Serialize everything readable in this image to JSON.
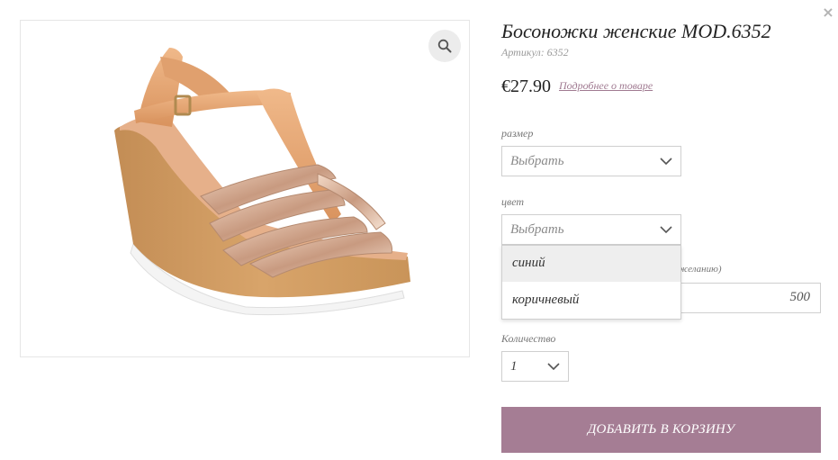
{
  "product": {
    "title": "Босоножки женские MOD.6352",
    "sku": "Артикул: 6352",
    "price": "€27.90",
    "details_link": "Подробнее о товаре",
    "image_alt": "sandal-image"
  },
  "options": {
    "size_label": "размер",
    "size_value": "Выбрать",
    "color_label": "цвет",
    "color_value": "Выбрать",
    "color_options": [
      "синий",
      "коричневый"
    ],
    "engraving_label_visible": "желанию)",
    "engraving_value": "500",
    "quantity_label": "Количество",
    "quantity_value": "1"
  },
  "actions": {
    "add_to_cart": "ДОБАВИТЬ В КОРЗИНУ",
    "close": "×"
  },
  "icons": {
    "zoom": "magnifier-icon",
    "close": "close-icon",
    "chevron": "chevron-down-icon"
  },
  "colors": {
    "accent": "#a57d94",
    "link": "#a07a91"
  }
}
